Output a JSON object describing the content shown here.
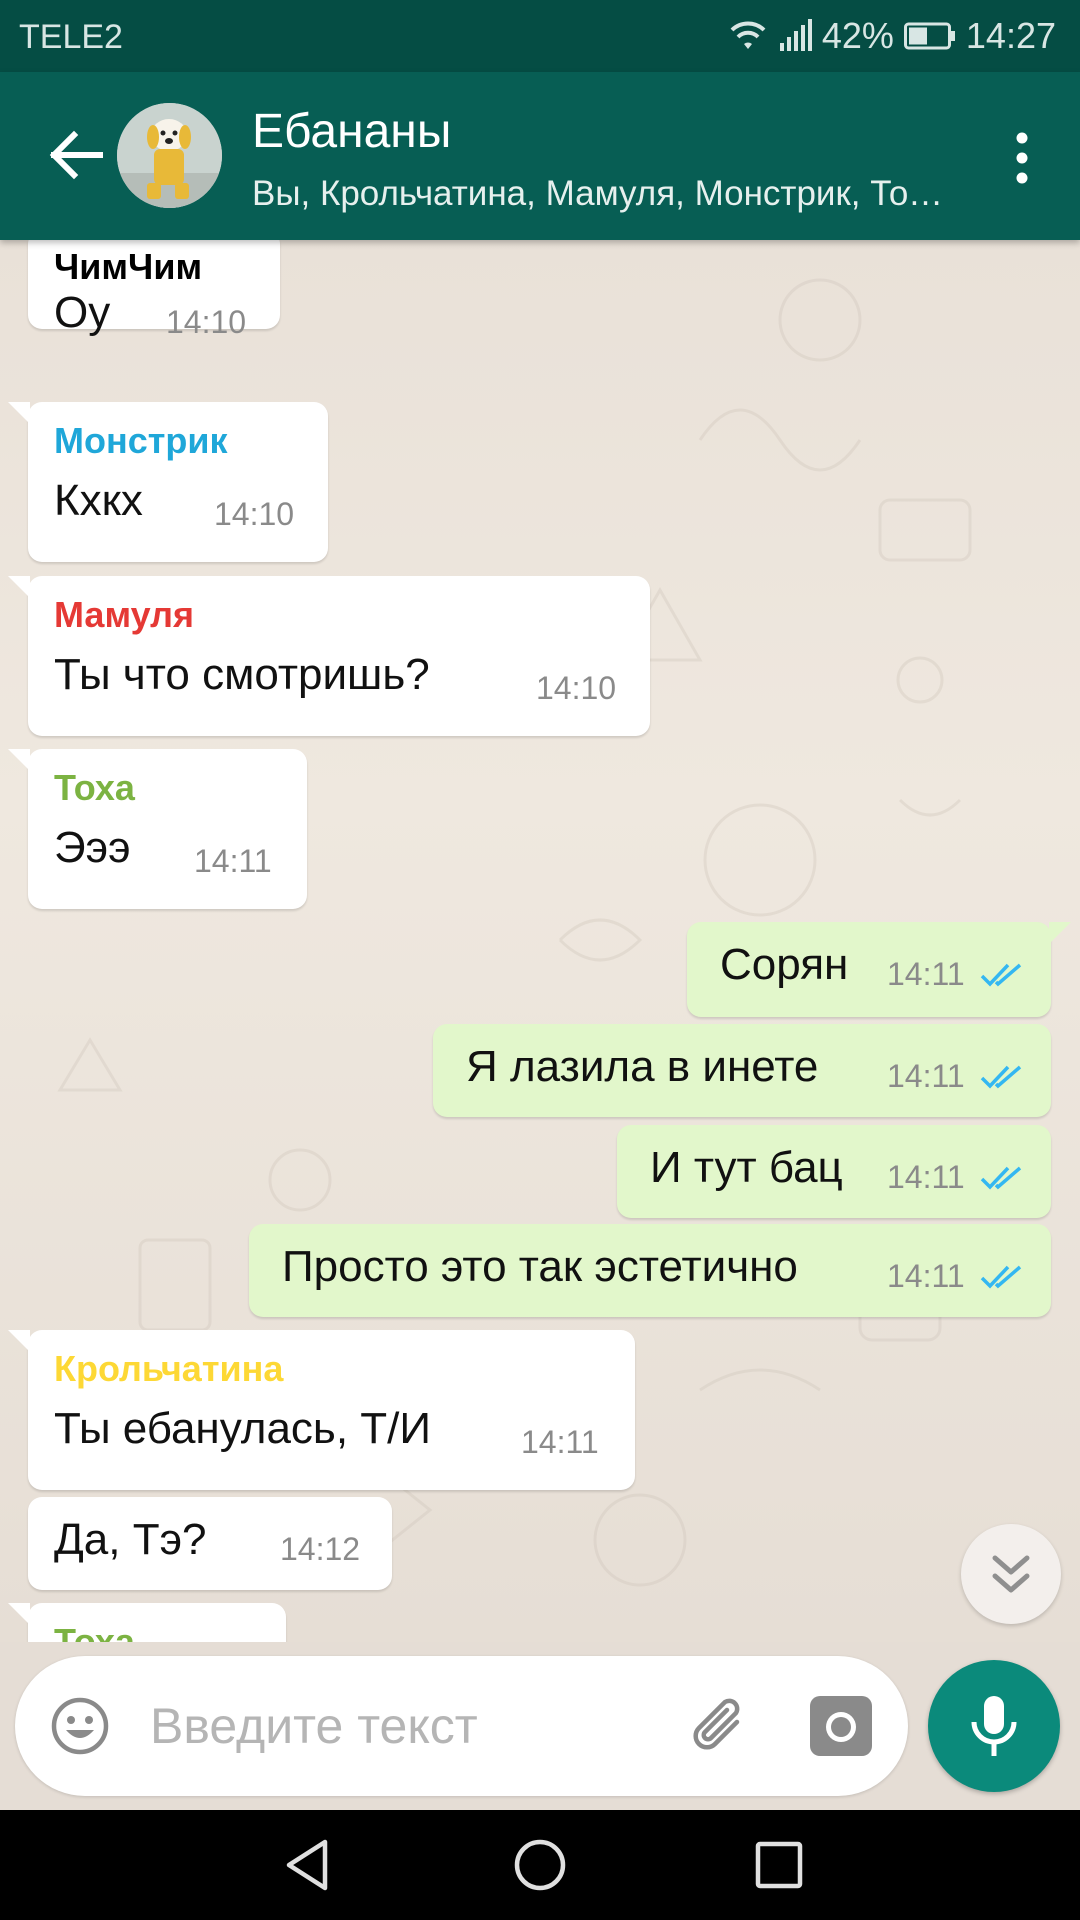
{
  "status_bar": {
    "carrier": "TELE2",
    "battery": "42%",
    "clock": "14:27",
    "icons": [
      "wifi-icon",
      "signal-icon",
      "battery-icon"
    ]
  },
  "header": {
    "back_icon": "arrow-left-icon",
    "title": "Ебананы",
    "subtitle": "Вы, Крольчатина, Мамуля, Монстрик, Тоха, ЧимЧим",
    "menu_icon": "more-vert-icon"
  },
  "colors": {
    "header": "#075e54",
    "status_bar": "#054d44",
    "outgoing_bubble": "#e2f7cb",
    "incoming_bubble": "#ffffff",
    "read_ticks": "#34b7f1",
    "mic_button": "#0b8a7b"
  },
  "messages": [
    {
      "sender": "ЧимЧим",
      "sender_color": "#000000",
      "text": "Оу",
      "time": "14:10"
    },
    {
      "sender": "Монстрик",
      "sender_color": "#1fa7d9",
      "text": "Кхкх",
      "time": "14:10"
    },
    {
      "sender": "Мамуля",
      "sender_color": "#e53935",
      "text": "Ты что смотришь?",
      "time": "14:10"
    },
    {
      "sender": "Тоха",
      "sender_color": "#7cb342",
      "text": "Эээ",
      "time": "14:11"
    },
    {
      "text": "Сорян",
      "time": "14:11",
      "status": "read"
    },
    {
      "text": "Я лазила в инете",
      "time": "14:11",
      "status": "read"
    },
    {
      "text": "И тут бац",
      "time": "14:11",
      "status": "read"
    },
    {
      "text": "Просто это так эстетично",
      "time": "14:11",
      "status": "read"
    },
    {
      "sender": "Крольчатина",
      "sender_color": "#fdd835",
      "text": "Ты ебанулась, Т/И",
      "time": "14:11"
    },
    {
      "text": "Да, Тэ?",
      "time": "14:12"
    },
    {
      "sender": "Тоха",
      "sender_color": "#7cb342"
    }
  ],
  "composer": {
    "placeholder": "Введите текст",
    "icons": [
      "emoji-icon",
      "attach-icon",
      "camera-icon",
      "mic-icon"
    ]
  },
  "nav": {
    "icons": [
      "back-triangle-icon",
      "home-circle-icon",
      "recents-square-icon"
    ]
  }
}
